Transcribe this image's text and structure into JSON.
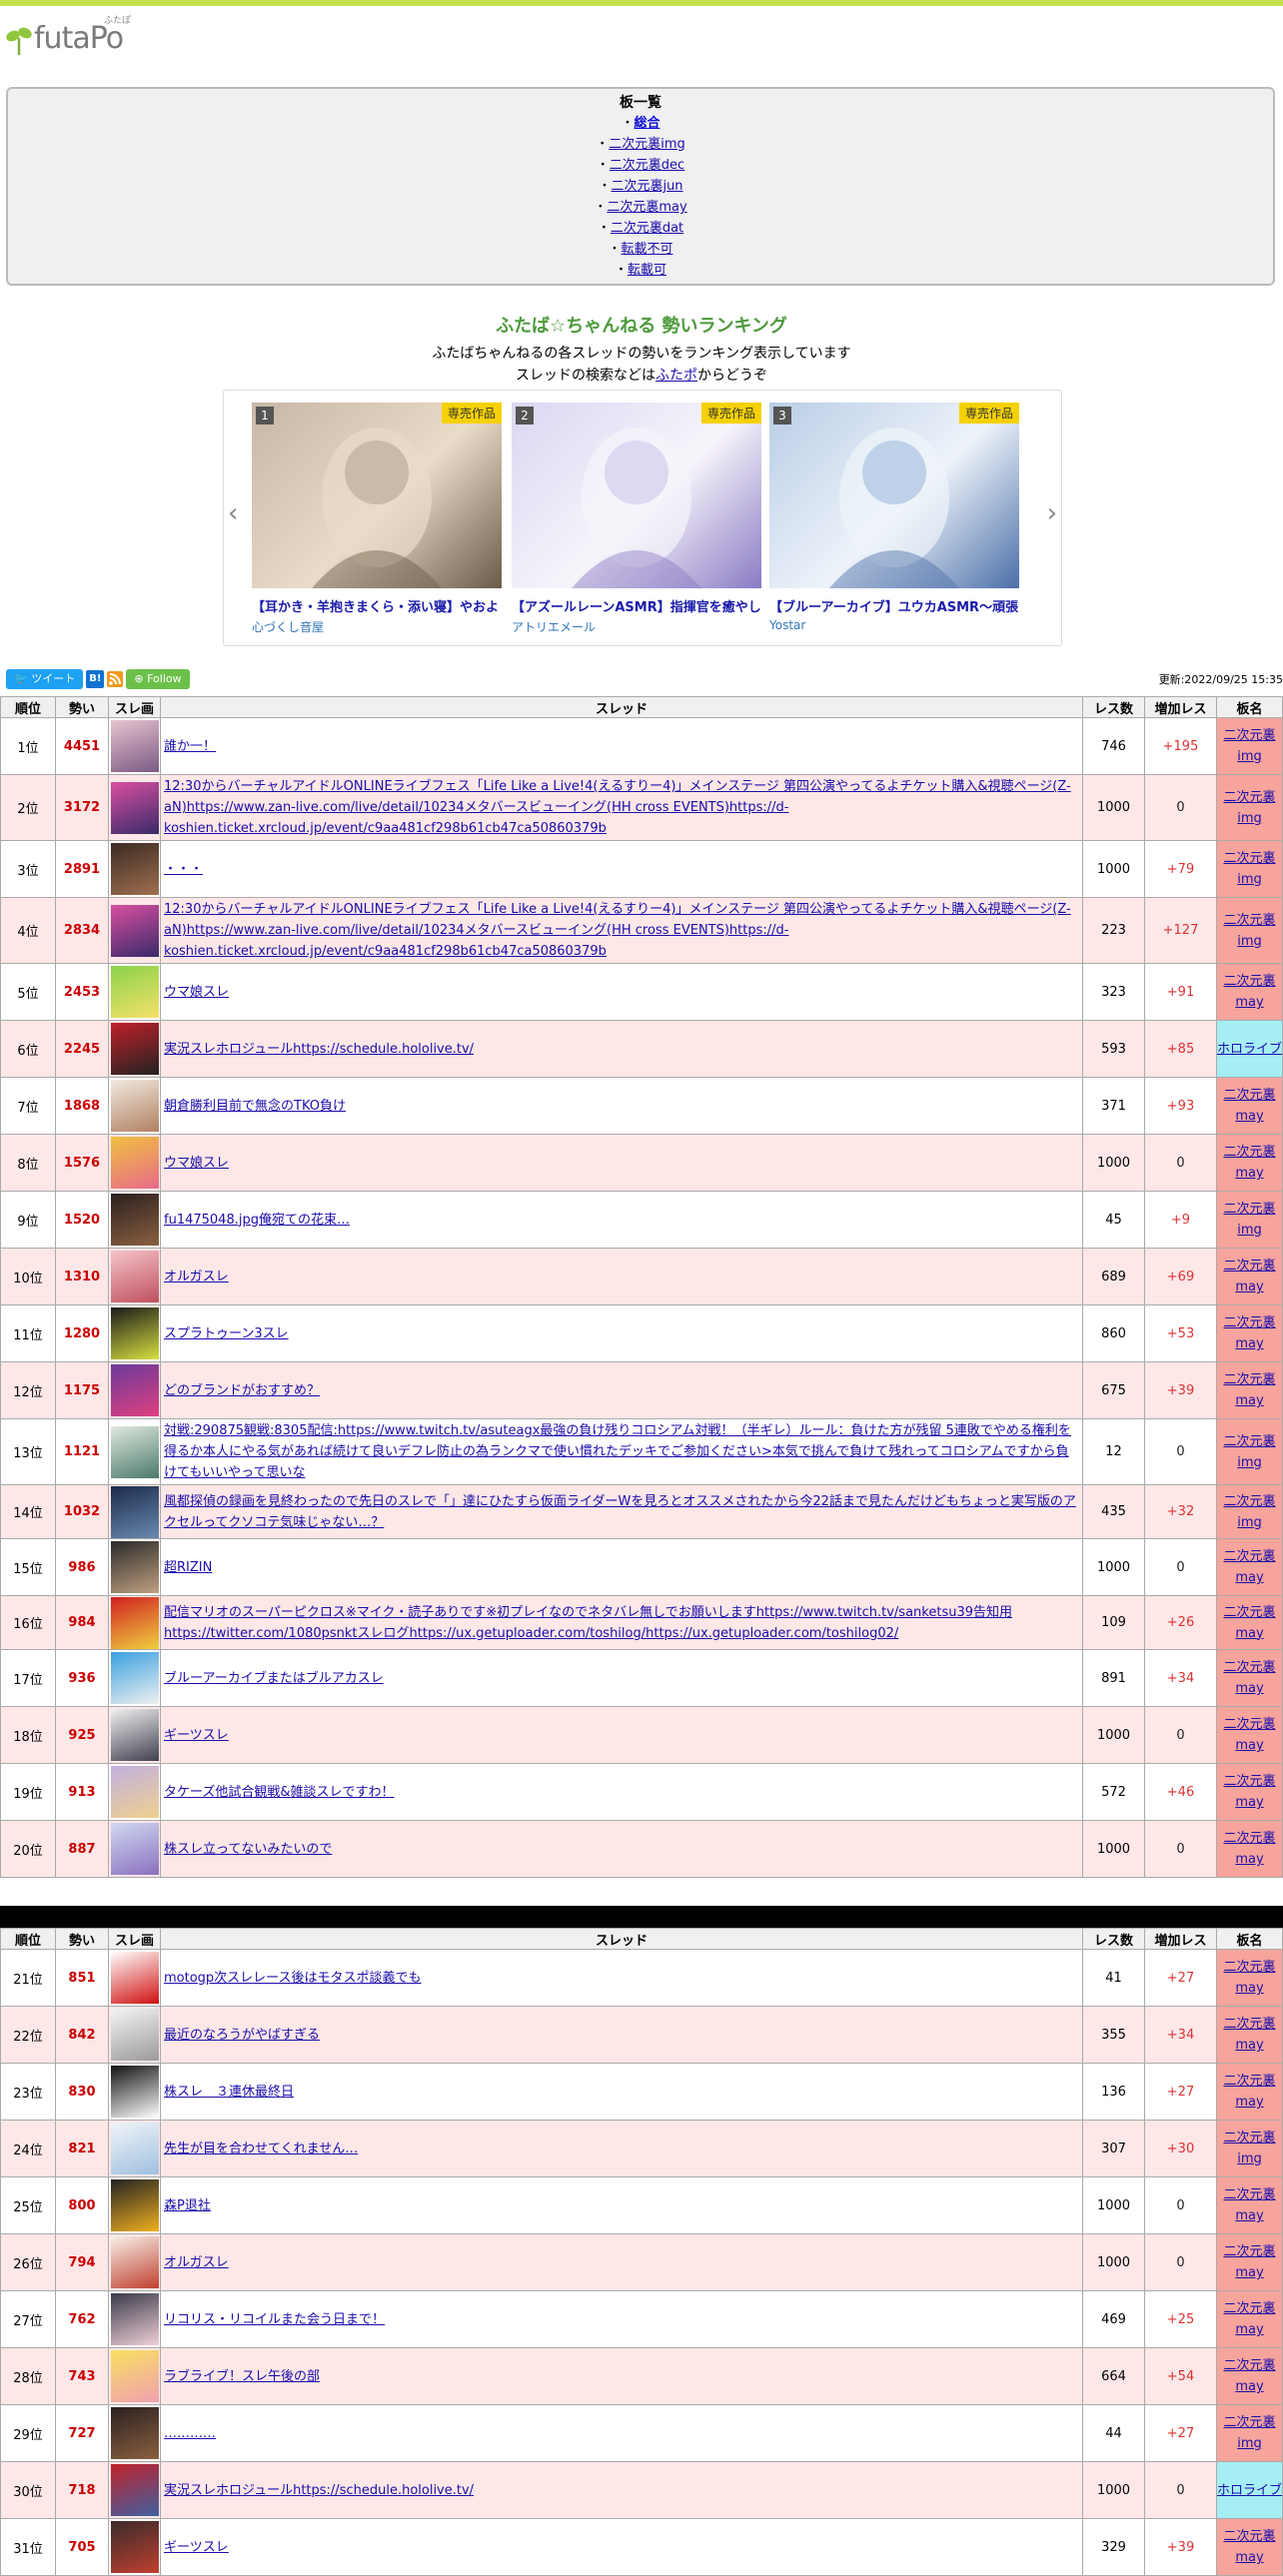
{
  "site": {
    "logo_text": "futaPo",
    "logo_ruby": "ふたぽ"
  },
  "boards": {
    "title": "板一覧",
    "items": [
      {
        "label": "総合",
        "bold": true
      },
      {
        "label": "二次元裏img"
      },
      {
        "label": "二次元裏dec"
      },
      {
        "label": "二次元裏jun"
      },
      {
        "label": "二次元裏may"
      },
      {
        "label": "二次元裏dat"
      },
      {
        "label": "転載不可"
      },
      {
        "label": "転載可"
      }
    ]
  },
  "intro": {
    "title": "ふたば☆ちゃんねる 勢いランキング",
    "line1": "ふたばちゃんねるの各スレッドの勢いをランキング表示しています",
    "line2_prefix": "スレッドの検索などは",
    "line2_link": "ふたポ",
    "line2_suffix": "からどうぞ"
  },
  "carousel": {
    "badge": "専売作品",
    "cards": [
      {
        "rank": "1",
        "title": "【耳かき・羊抱きまくら・添い寝】やおよ",
        "maker": "心づくし音屋",
        "colors": [
          "#c8b6a6",
          "#e9dcc9",
          "#6b5a48"
        ]
      },
      {
        "rank": "2",
        "title": "【アズールレーンASMR】指揮官を癒やし",
        "maker": "アトリエメール",
        "colors": [
          "#dcd6f2",
          "#f7f4fb",
          "#8a7bc4"
        ]
      },
      {
        "rank": "3",
        "title": "【ブルーアーカイブ】ユウカASMR～頑張",
        "maker": "Yostar",
        "colors": [
          "#b9cde6",
          "#eef3fa",
          "#4b6fa8"
        ]
      }
    ]
  },
  "social": {
    "tweet": "ツイート",
    "hatena": "B!",
    "follow": "Follow"
  },
  "updated": "更新:2022/09/25 15:35",
  "table_headers": {
    "rank": "順位",
    "momentum": "勢い",
    "thumb": "スレ画",
    "thread": "スレッド",
    "res": "レス数",
    "inc": "増加レス",
    "board": "板名"
  },
  "rows1": [
    {
      "rank": "1位",
      "momentum": "4451",
      "title": "誰か一！",
      "res": "746",
      "inc": "+195",
      "board": "二次元裏img",
      "live": false,
      "lines": 1,
      "colors": [
        "#e8c3cf",
        "#7a5a84"
      ]
    },
    {
      "rank": "2位",
      "momentum": "3172",
      "title": "12:30からバーチャルアイドルONLINEライブフェス「Life Like a Live!4(えるすりー4)」メインステージ 第四公演やってるよチケット購入&視聴ページ(Z-aN)https://www.zan-live.com/live/detail/10234メタバースビューイング(HH cross EVENTS)https://d-koshien.ticket.xrcloud.jp/event/c9aa481cf298b61cb47ca50860379b",
      "res": "1000",
      "inc": "0",
      "board": "二次元裏img",
      "live": false,
      "lines": 3,
      "colors": [
        "#d94fa0",
        "#3a2a6a"
      ]
    },
    {
      "rank": "3位",
      "momentum": "2891",
      "title": "・・・",
      "res": "1000",
      "inc": "+79",
      "board": "二次元裏img",
      "live": false,
      "lines": 1,
      "colors": [
        "#3b2a22",
        "#a07050"
      ]
    },
    {
      "rank": "4位",
      "momentum": "2834",
      "title": "12:30からバーチャルアイドルONLINEライブフェス「Life Like a Live!4(えるすりー4)」メインステージ 第四公演やってるよチケット購入&視聴ページ(Z-aN)https://www.zan-live.com/live/detail/10234メタバースビューイング(HH cross EVENTS)https://d-koshien.ticket.xrcloud.jp/event/c9aa481cf298b61cb47ca50860379b",
      "res": "223",
      "inc": "+127",
      "board": "二次元裏img",
      "live": false,
      "lines": 3,
      "colors": [
        "#d94fa0",
        "#3a2a6a"
      ]
    },
    {
      "rank": "5位",
      "momentum": "2453",
      "title": "ウマ娘スレ",
      "res": "323",
      "inc": "+91",
      "board": "二次元裏may",
      "live": false,
      "lines": 1,
      "colors": [
        "#8bd24a",
        "#f4e16a"
      ]
    },
    {
      "rank": "6位",
      "momentum": "2245",
      "title": "実況スレホロジュールhttps://schedule.hololive.tv/",
      "res": "593",
      "inc": "+85",
      "board": "ホロライブ",
      "live": true,
      "lines": 1,
      "colors": [
        "#c0212a",
        "#222222"
      ]
    },
    {
      "rank": "7位",
      "momentum": "1868",
      "title": "朝倉勝利目前で無念のTKO負け",
      "res": "371",
      "inc": "+93",
      "board": "二次元裏may",
      "live": false,
      "lines": 1,
      "colors": [
        "#f2e9e1",
        "#b08060"
      ]
    },
    {
      "rank": "8位",
      "momentum": "1576",
      "title": "ウマ娘スレ",
      "res": "1000",
      "inc": "0",
      "board": "二次元裏may",
      "live": false,
      "lines": 1,
      "colors": [
        "#f0c040",
        "#e86a8a"
      ]
    },
    {
      "rank": "9位",
      "momentum": "1520",
      "title": "fu1475048.jpg俺宛ての花束…",
      "res": "45",
      "inc": "+9",
      "board": "二次元裏img",
      "live": false,
      "lines": 1,
      "colors": [
        "#2b2020",
        "#8a6040"
      ]
    },
    {
      "rank": "10位",
      "momentum": "1310",
      "title": "オルガスレ",
      "res": "689",
      "inc": "+69",
      "board": "二次元裏may",
      "live": false,
      "lines": 1,
      "colors": [
        "#f4c4c8",
        "#c05060"
      ]
    },
    {
      "rank": "11位",
      "momentum": "1280",
      "title": "スプラトゥーン3スレ",
      "res": "860",
      "inc": "+53",
      "board": "二次元裏may",
      "live": false,
      "lines": 1,
      "colors": [
        "#1a1a1a",
        "#d8e040"
      ]
    },
    {
      "rank": "12位",
      "momentum": "1175",
      "title": "どのブランドがおすすめ？",
      "res": "675",
      "inc": "+39",
      "board": "二次元裏may",
      "live": false,
      "lines": 1,
      "colors": [
        "#6a3a9a",
        "#e04080"
      ]
    },
    {
      "rank": "13位",
      "momentum": "1121",
      "title": "対戦:290875観戦:8305配信:https://www.twitch.tv/asuteagx最強の負け残りコロシアム対戦！（半ギレ）ルール：負けた方が残留 5連敗でやめる権利を得るか本人にやる気があれば続けて良いデフレ防止の為ランクマで使い慣れたデッキでご参加ください>本気で挑んで負けて残れってコロシアムですから負けてもいいやって思いな",
      "res": "12",
      "inc": "0",
      "board": "二次元裏img",
      "live": false,
      "lines": 3,
      "colors": [
        "#e0e8e0",
        "#4a7a6a"
      ]
    },
    {
      "rank": "14位",
      "momentum": "1032",
      "title": "風都探偵の録画を見終わったので先日のスレで「」達にひたすら仮面ライダーWを見ろとオススメされたから今22話まで見たんだけどもちょっと実写版のアクセルってクソコテ気味じゃない…？",
      "res": "435",
      "inc": "+32",
      "board": "二次元裏img",
      "live": false,
      "lines": 2,
      "colors": [
        "#1a2a4a",
        "#6a8ab0"
      ]
    },
    {
      "rank": "15位",
      "momentum": "986",
      "title": "超RIZIN",
      "res": "1000",
      "inc": "0",
      "board": "二次元裏may",
      "live": false,
      "lines": 1,
      "colors": [
        "#2a2a2a",
        "#c0a080"
      ]
    },
    {
      "rank": "16位",
      "momentum": "984",
      "title": "配信マリオのスーパーピクロス※マイク・読子ありです※初プレイなのでネタバレ無しでお願いしますhttps://www.twitch.tv/sanketsu39告知用https://twitter.com/1080psnktスレログhttps://ux.getuploader.com/toshilog/https://ux.getuploader.com/toshilog02/",
      "res": "109",
      "inc": "+26",
      "board": "二次元裏may",
      "live": false,
      "lines": 2,
      "colors": [
        "#d02020",
        "#f0d040"
      ]
    },
    {
      "rank": "17位",
      "momentum": "936",
      "title": "ブルーアーカイブまたはブルアカスレ",
      "res": "891",
      "inc": "+34",
      "board": "二次元裏may",
      "live": false,
      "lines": 1,
      "colors": [
        "#3aa0e0",
        "#f0f0f0"
      ]
    },
    {
      "rank": "18位",
      "momentum": "925",
      "title": "ギーツスレ",
      "res": "1000",
      "inc": "0",
      "board": "二次元裏may",
      "live": false,
      "lines": 1,
      "colors": [
        "#f0f0f0",
        "#404050"
      ]
    },
    {
      "rank": "19位",
      "momentum": "913",
      "title": "タケーズ他試合観戦&雑談スレですわ！",
      "res": "572",
      "inc": "+46",
      "board": "二次元裏may",
      "live": false,
      "lines": 1,
      "colors": [
        "#c0b0e0",
        "#f0d090"
      ]
    },
    {
      "rank": "20位",
      "momentum": "887",
      "title": "株スレ立ってないみたいので",
      "res": "1000",
      "inc": "0",
      "board": "二次元裏may",
      "live": false,
      "lines": 1,
      "colors": [
        "#d0d8f0",
        "#8a70c0"
      ]
    }
  ],
  "rows2": [
    {
      "rank": "21位",
      "momentum": "851",
      "title": "motogp次スレレース後はモタスポ談義でも",
      "res": "41",
      "inc": "+27",
      "board": "二次元裏may",
      "live": false,
      "lines": 1,
      "colors": [
        "#ffffff",
        "#d01010"
      ]
    },
    {
      "rank": "22位",
      "momentum": "842",
      "title": "最近のなろうがやばすぎる",
      "res": "355",
      "inc": "+34",
      "board": "二次元裏may",
      "live": false,
      "lines": 1,
      "colors": [
        "#f4f4f4",
        "#9a9a9a"
      ]
    },
    {
      "rank": "23位",
      "momentum": "830",
      "title": "株スレ　３連休最終日",
      "res": "136",
      "inc": "+27",
      "board": "二次元裏may",
      "live": false,
      "lines": 1,
      "colors": [
        "#111111",
        "#ffffff"
      ]
    },
    {
      "rank": "24位",
      "momentum": "821",
      "title": "先生が目を合わせてくれません…",
      "res": "307",
      "inc": "+30",
      "board": "二次元裏img",
      "live": false,
      "lines": 1,
      "colors": [
        "#f0f4f8",
        "#a0c0e0"
      ]
    },
    {
      "rank": "25位",
      "momentum": "800",
      "title": "森P退社",
      "res": "1000",
      "inc": "0",
      "board": "二次元裏may",
      "live": false,
      "lines": 1,
      "colors": [
        "#222222",
        "#f0b020"
      ]
    },
    {
      "rank": "26位",
      "momentum": "794",
      "title": "オルガスレ",
      "res": "1000",
      "inc": "0",
      "board": "二次元裏may",
      "live": false,
      "lines": 1,
      "colors": [
        "#f8f0e8",
        "#c04030"
      ]
    },
    {
      "rank": "27位",
      "momentum": "762",
      "title": "リコリス・リコイルまた会う日まで！",
      "res": "469",
      "inc": "+25",
      "board": "二次元裏may",
      "live": false,
      "lines": 1,
      "colors": [
        "#3a3a4a",
        "#f0d0d8"
      ]
    },
    {
      "rank": "28位",
      "momentum": "743",
      "title": "ラブライブ！スレ午後の部",
      "res": "664",
      "inc": "+54",
      "board": "二次元裏may",
      "live": false,
      "lines": 1,
      "colors": [
        "#f8e060",
        "#f0a0b0"
      ]
    },
    {
      "rank": "29位",
      "momentum": "727",
      "title": "…………",
      "res": "44",
      "inc": "+27",
      "board": "二次元裏img",
      "live": false,
      "lines": 1,
      "colors": [
        "#2b2020",
        "#8a6040"
      ]
    },
    {
      "rank": "30位",
      "momentum": "718",
      "title": "実況スレホロジュールhttps://schedule.hololive.tv/",
      "res": "1000",
      "inc": "0",
      "board": "ホロライブ",
      "live": true,
      "lines": 1,
      "colors": [
        "#c0212a",
        "#4060a0"
      ]
    },
    {
      "rank": "31位",
      "momentum": "705",
      "title": "ギーツスレ",
      "res": "329",
      "inc": "+39",
      "board": "二次元裏may",
      "live": false,
      "lines": 1,
      "colors": [
        "#3a2a2a",
        "#c04030"
      ]
    }
  ]
}
